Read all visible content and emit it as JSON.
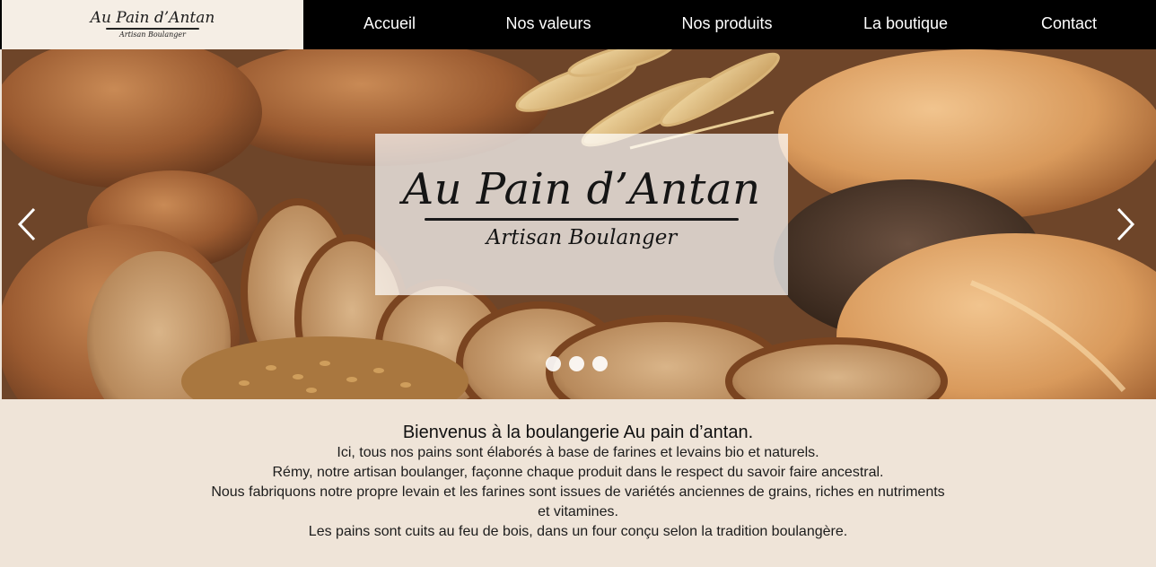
{
  "logo": {
    "title": "Au Pain d’Antan",
    "subtitle": "Artisan Boulanger"
  },
  "nav": {
    "items": [
      "Accueil",
      "Nos valeurs",
      "Nos produits",
      "La boutique",
      "Contact"
    ]
  },
  "hero": {
    "title": "Au Pain d’Antan",
    "subtitle": "Artisan Boulanger",
    "slides_count": 3,
    "left_arrow_icon": "chevron-left-icon",
    "right_arrow_icon": "chevron-right-icon"
  },
  "welcome": {
    "title": "Bienvenus à la boulangerie Au pain d’antan.",
    "lines": [
      "Ici, tous nos pains sont élaborés à base de farines et levains bio et naturels.",
      "Rémy, notre artisan boulanger, façonne chaque produit dans le respect du savoir faire ancestral.",
      "Nous fabriquons notre propre levain et les farines sont issues de variétés anciennes de grains, riches en nutriments et vitamines.",
      "Les pains sont cuits au feu de bois, dans un four conçu selon la tradition boulangère."
    ]
  },
  "colors": {
    "header_bg": "#000000",
    "logo_bg": "#f5eee5",
    "page_bg": "#efe4d8",
    "nav_text": "#ffffff"
  }
}
